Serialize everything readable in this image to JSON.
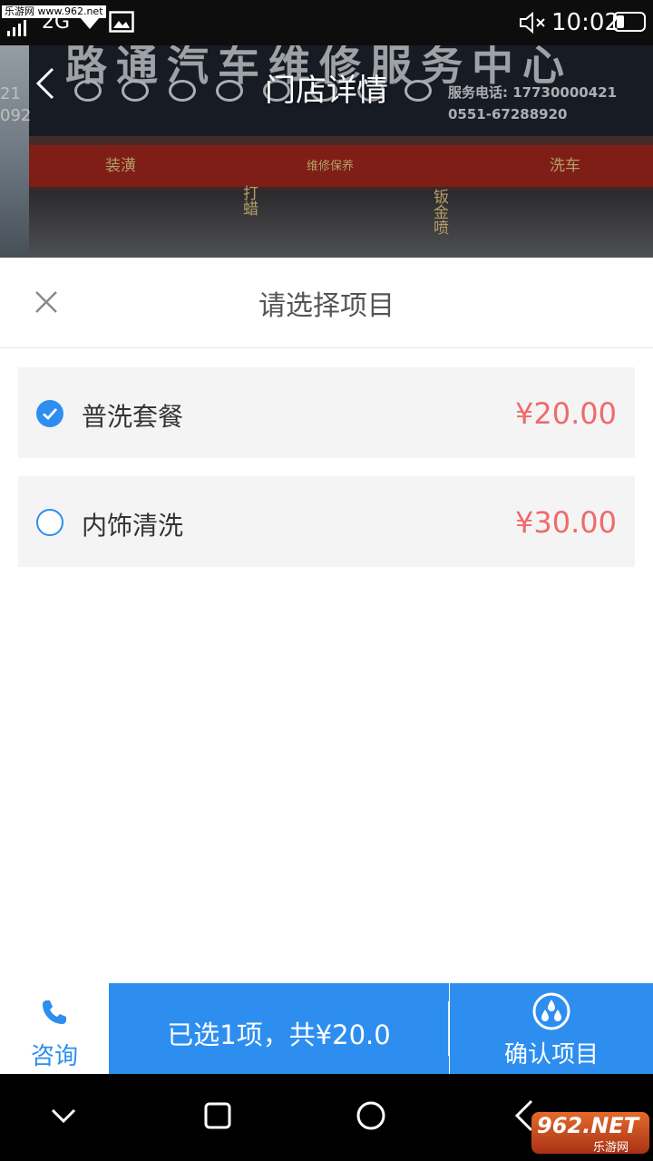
{
  "status_bar": {
    "watermark": "乐游网 www.962.net",
    "network": "2G",
    "time": "10:02"
  },
  "store_header": {
    "title": "门店详情",
    "sign_text": "路通汽车维修服务中心",
    "sign_phone_1": "服务电话: 17730000421",
    "sign_phone_2": "0551-67288920",
    "shop_labels": [
      "装潢",
      "维修保养",
      "洗车",
      "钣金喷",
      "打蜡"
    ],
    "left_edge_digits": [
      "21",
      "092"
    ]
  },
  "sheet": {
    "title": "请选择项目",
    "items": [
      {
        "name": "普洗套餐",
        "price": "¥20.00",
        "selected": true
      },
      {
        "name": "内饰清洗",
        "price": "¥30.00",
        "selected": false
      }
    ]
  },
  "action_bar": {
    "consult_label": "咨询",
    "summary": "已选1项，共¥20.0",
    "confirm_label": "确认项目"
  },
  "watermark_bottom": {
    "main": "962.NET",
    "sub": "乐游网"
  },
  "colors": {
    "accent": "#2d8ef0",
    "price": "#f06a6a",
    "item_bg": "#f4f4f4"
  },
  "icons": {
    "back": "chevron-left-icon",
    "close": "close-icon",
    "checked": "check-circle-icon",
    "unchecked": "empty-circle-icon",
    "consult": "phone-icon",
    "confirm": "water-drops-icon"
  }
}
